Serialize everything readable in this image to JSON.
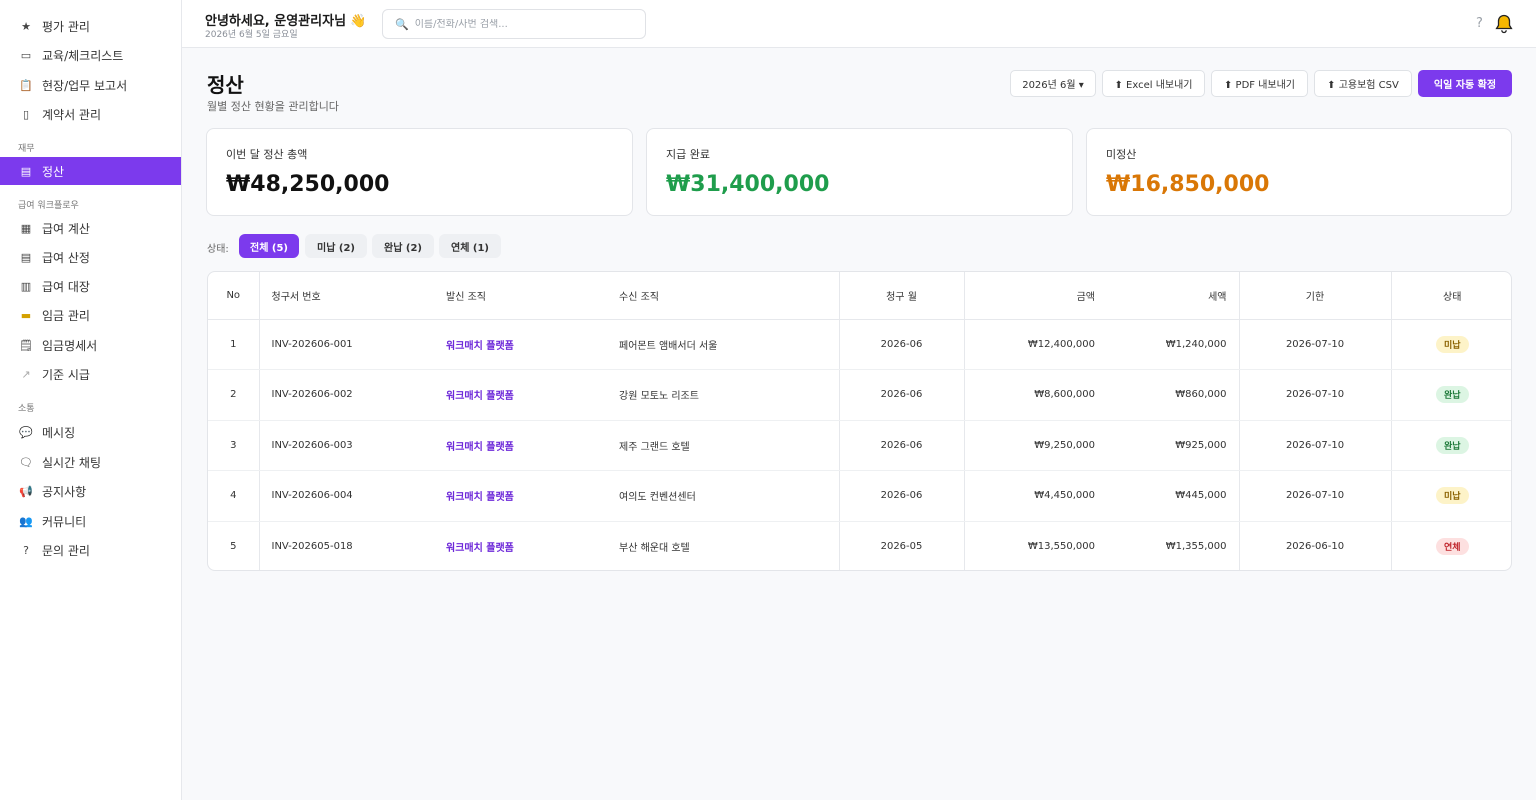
{
  "sidebar": {
    "items_top": [
      {
        "icon": "star-icon",
        "glyph": "★",
        "label": "평가 관리"
      },
      {
        "icon": "checklist-icon",
        "glyph": "▭",
        "label": "교육/체크리스트"
      },
      {
        "icon": "clipboard-icon",
        "glyph": "📋",
        "label": "현장/업무 보고서"
      },
      {
        "icon": "document-icon",
        "glyph": "▯",
        "label": "계약서 관리"
      }
    ],
    "section_finance": "재무",
    "settlement": {
      "icon": "ledger-icon",
      "glyph": "▤",
      "label": "정산"
    },
    "section_payroll": "급여 워크플로우",
    "items_payroll": [
      {
        "icon": "calc-icon",
        "glyph": "▦",
        "label": "급여 계산"
      },
      {
        "icon": "list-icon",
        "glyph": "▤",
        "label": "급여 산정"
      },
      {
        "icon": "ledger-book-icon",
        "glyph": "▥",
        "label": "급여 대장"
      },
      {
        "icon": "card-icon",
        "glyph": "▬",
        "label": "임금 관리"
      },
      {
        "icon": "payslip-icon",
        "glyph": "🗒",
        "label": "임금명세서"
      },
      {
        "icon": "wage-icon",
        "glyph": "↗",
        "label": "기준 시급"
      }
    ],
    "section_comm": "소통",
    "items_comm": [
      {
        "icon": "message-icon",
        "glyph": "💬",
        "label": "메시징"
      },
      {
        "icon": "chat-icon",
        "glyph": "🗨",
        "label": "실시간 채팅"
      },
      {
        "icon": "megaphone-icon",
        "glyph": "📢",
        "label": "공지사항"
      },
      {
        "icon": "community-icon",
        "glyph": "👥",
        "label": "커뮤니티"
      },
      {
        "icon": "question-icon",
        "glyph": "?",
        "label": "문의 관리"
      }
    ]
  },
  "header": {
    "greeting": "안녕하세요, 운영관리자님",
    "hand": "👋",
    "date": "2026년 6월 5일 금요일",
    "search_placeholder": "이름/전화/사번 검색...",
    "help": "?"
  },
  "page": {
    "title": "정산",
    "subtitle": "월별 정산 현황을 관리합니다"
  },
  "toolbar": {
    "month": "2026년 6월 ▾",
    "excel": "⬆ Excel 내보내기",
    "pdf": "⬆ PDF 내보내기",
    "csv": "⬆ 고용보험 CSV",
    "auto_confirm": "익일 자동 확정"
  },
  "stats": [
    {
      "label": "이번 달 정산 총액",
      "value": "₩48,250,000",
      "color": "#111111"
    },
    {
      "label": "지급 완료",
      "value": "₩31,400,000",
      "color": "#1f9d4c"
    },
    {
      "label": "미정산",
      "value": "₩16,850,000",
      "color": "#d97706"
    }
  ],
  "filters": {
    "label": "상태:",
    "chips": [
      "전체 (5)",
      "미납 (2)",
      "완납 (2)",
      "연체 (1)"
    ]
  },
  "table": {
    "headers": [
      "No",
      "청구서 번호",
      "발신 조직",
      "수신 조직",
      "청구 월",
      "금액",
      "세액",
      "기한",
      "상태"
    ],
    "rows": [
      {
        "no": "1",
        "invoice": "INV-202606-001",
        "from": "워크매치 플랫폼",
        "to": "페어몬트 앰배서더 서울",
        "month": "2026-06",
        "amount": "₩12,400,000",
        "tax": "₩1,240,000",
        "due": "2026-07-10",
        "status": "미납",
        "status_kind": "unpaid"
      },
      {
        "no": "2",
        "invoice": "INV-202606-002",
        "from": "워크매치 플랫폼",
        "to": "강원 모토노 리조트",
        "month": "2026-06",
        "amount": "₩8,600,000",
        "tax": "₩860,000",
        "due": "2026-07-10",
        "status": "완납",
        "status_kind": "paid"
      },
      {
        "no": "3",
        "invoice": "INV-202606-003",
        "from": "워크매치 플랫폼",
        "to": "제주 그랜드 호텔",
        "month": "2026-06",
        "amount": "₩9,250,000",
        "tax": "₩925,000",
        "due": "2026-07-10",
        "status": "완납",
        "status_kind": "paid"
      },
      {
        "no": "4",
        "invoice": "INV-202606-004",
        "from": "워크매치 플랫폼",
        "to": "여의도 컨벤션센터",
        "month": "2026-06",
        "amount": "₩4,450,000",
        "tax": "₩445,000",
        "due": "2026-07-10",
        "status": "미납",
        "status_kind": "unpaid"
      },
      {
        "no": "5",
        "invoice": "INV-202605-018",
        "from": "워크매치 플랫폼",
        "to": "부산 해운대 호텔",
        "month": "2026-05",
        "amount": "₩13,550,000",
        "tax": "₩1,355,000",
        "due": "2026-06-10",
        "status": "연체",
        "status_kind": "overdue"
      }
    ]
  },
  "colors": {
    "accent": "#7c3aed",
    "bell": "#f5b700"
  }
}
